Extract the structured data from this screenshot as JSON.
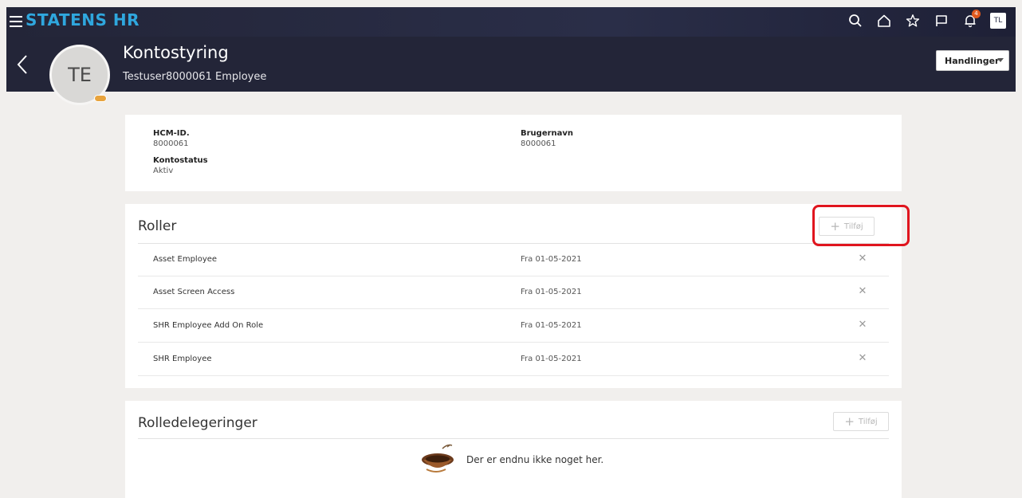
{
  "header": {
    "brand": "STATENS HR",
    "user_initials": "TL",
    "notification_count": "4"
  },
  "page": {
    "title": "Kontostyring",
    "subtitle": "Testuser8000061 Employee",
    "avatar_initials": "TE",
    "actions_label": "Handlinger"
  },
  "info": {
    "hcm_label": "HCM-ID.",
    "hcm_value": "8000061",
    "username_label": "Brugernavn",
    "username_value": "8000061",
    "status_label": "Kontostatus",
    "status_value": "Aktiv"
  },
  "roles": {
    "title": "Roller",
    "add_label": "Tilføj",
    "items": [
      {
        "name": "Asset Employee",
        "date": "Fra 01-05-2021"
      },
      {
        "name": "Asset Screen Access",
        "date": "Fra 01-05-2021"
      },
      {
        "name": "SHR Employee Add On Role",
        "date": "Fra 01-05-2021"
      },
      {
        "name": "SHR Employee",
        "date": "Fra 01-05-2021"
      }
    ]
  },
  "delegations": {
    "title": "Rolledelegeringer",
    "add_label": "Tilføj",
    "empty_text": "Der er endnu ikke noget her."
  },
  "colors": {
    "brand": "#2fa7de",
    "header_bg": "#232538",
    "highlight": "#e0151e"
  }
}
